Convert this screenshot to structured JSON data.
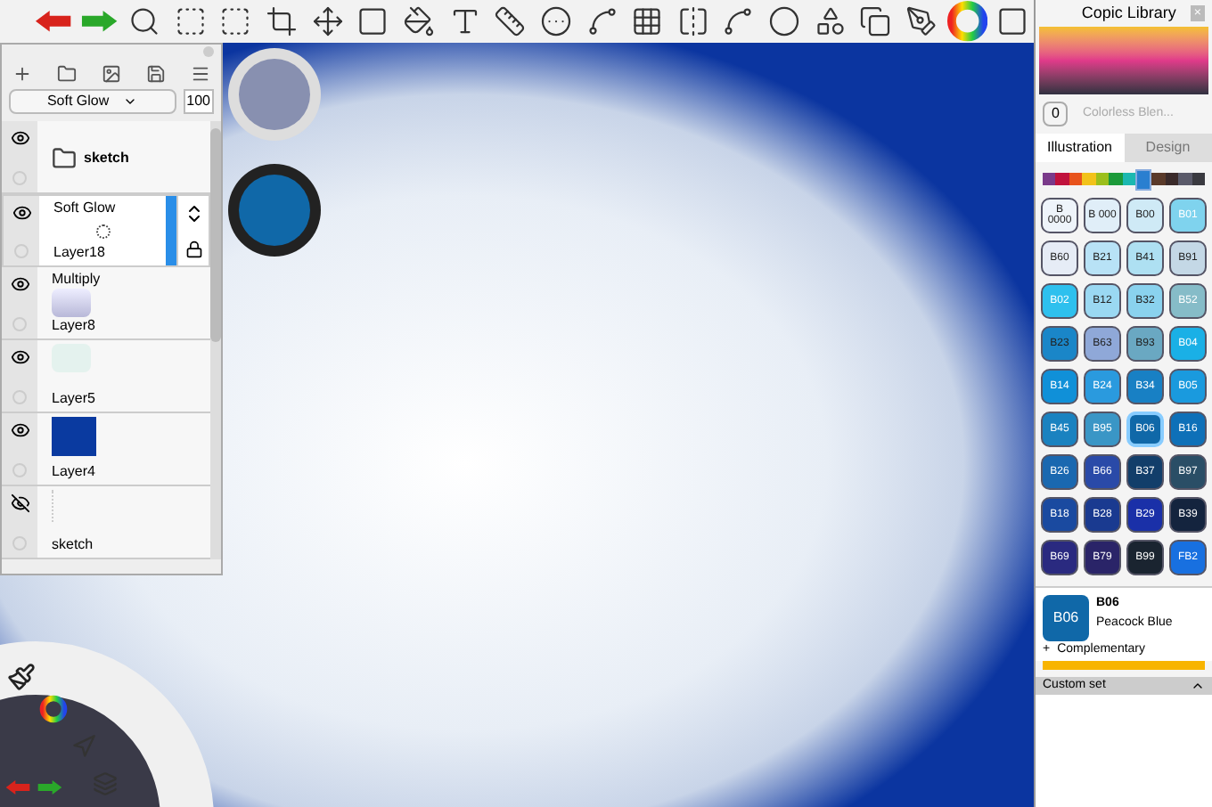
{
  "layers_panel": {
    "blend_mode": "Soft Glow",
    "opacity": "100",
    "layers": [
      {
        "kind": "group",
        "name": "sketch",
        "visible": true,
        "selected": false
      },
      {
        "kind": "glow",
        "blend": "Soft Glow",
        "name": "Layer18",
        "visible": true,
        "selected": true
      },
      {
        "kind": "cloud",
        "blend": "Multiply",
        "name": "Layer8",
        "visible": true,
        "selected": false
      },
      {
        "kind": "faint",
        "name": "Layer5",
        "visible": true,
        "selected": false
      },
      {
        "kind": "fill",
        "name": "Layer4",
        "visible": true,
        "selected": false
      },
      {
        "kind": "sketch",
        "name": "sketch",
        "visible": false,
        "selected": false
      }
    ]
  },
  "copic_library": {
    "title": "Copic Library",
    "close": "×",
    "blender_code": "0",
    "blender_name": "Colorless Blen...",
    "tabs": [
      {
        "label": "Illustration",
        "selected": true
      },
      {
        "label": "Design",
        "selected": false
      }
    ],
    "hues": [
      {
        "color": "#7a3a8a",
        "selected": false
      },
      {
        "color": "#c0123c",
        "selected": false
      },
      {
        "color": "#e8531c",
        "selected": false
      },
      {
        "color": "#f2c21a",
        "selected": false
      },
      {
        "color": "#9bbf1c",
        "selected": false
      },
      {
        "color": "#1c9a3a",
        "selected": false
      },
      {
        "color": "#1cb8b0",
        "selected": false
      },
      {
        "color": "#2a7fd0",
        "selected": true
      },
      {
        "color": "#5a3a2a",
        "selected": false
      },
      {
        "color": "#3a2a2a",
        "selected": false
      },
      {
        "color": "#5a5a6a",
        "selected": false
      },
      {
        "color": "#3a3a40",
        "selected": false
      }
    ],
    "swatches": [
      {
        "code": "B 0000",
        "color": "#eef4fa",
        "selected": false
      },
      {
        "code": "B 000",
        "color": "#e0eef8",
        "selected": false
      },
      {
        "code": "B00",
        "color": "#cfeaf6",
        "selected": false
      },
      {
        "code": "B01",
        "color": "#7fd3ee",
        "selected": false
      },
      {
        "code": "B60",
        "color": "#e6ecf6",
        "selected": false
      },
      {
        "code": "B21",
        "color": "#b8e2f6",
        "selected": false
      },
      {
        "code": "B41",
        "color": "#aee0f2",
        "selected": false
      },
      {
        "code": "B91",
        "color": "#c4d8e6",
        "selected": false
      },
      {
        "code": "B02",
        "color": "#2ec0ee",
        "selected": false
      },
      {
        "code": "B12",
        "color": "#9ad8f2",
        "selected": false
      },
      {
        "code": "B32",
        "color": "#8ad2ee",
        "selected": false
      },
      {
        "code": "B52",
        "color": "#86bcc8",
        "selected": false
      },
      {
        "code": "B23",
        "color": "#1a86c8",
        "selected": false
      },
      {
        "code": "B63",
        "color": "#8fa8d8",
        "selected": false
      },
      {
        "code": "B93",
        "color": "#6aa8c2",
        "selected": false
      },
      {
        "code": "B04",
        "color": "#1ab0e6",
        "selected": false
      },
      {
        "code": "B14",
        "color": "#1090d8",
        "selected": false
      },
      {
        "code": "B24",
        "color": "#2a9ade",
        "selected": false
      },
      {
        "code": "B34",
        "color": "#1880c4",
        "selected": false
      },
      {
        "code": "B05",
        "color": "#1a9ade",
        "selected": false
      },
      {
        "code": "B45",
        "color": "#1a82c0",
        "selected": false
      },
      {
        "code": "B95",
        "color": "#3a96c6",
        "selected": false
      },
      {
        "code": "B06",
        "color": "#1068a8",
        "selected": true
      },
      {
        "code": "B16",
        "color": "#0e70b8",
        "selected": false
      },
      {
        "code": "B26",
        "color": "#1a68b0",
        "selected": false
      },
      {
        "code": "B66",
        "color": "#2a4aa8",
        "selected": false
      },
      {
        "code": "B37",
        "color": "#123e6a",
        "selected": false
      },
      {
        "code": "B97",
        "color": "#2a4e66",
        "selected": false
      },
      {
        "code": "B18",
        "color": "#1a4aa0",
        "selected": false
      },
      {
        "code": "B28",
        "color": "#1a3a90",
        "selected": false
      },
      {
        "code": "B29",
        "color": "#1a30a8",
        "selected": false
      },
      {
        "code": "B39",
        "color": "#14243e",
        "selected": false
      },
      {
        "code": "B69",
        "color": "#2a2a80",
        "selected": false
      },
      {
        "code": "B79",
        "color": "#2a2468",
        "selected": false
      },
      {
        "code": "B99",
        "color": "#1a2430",
        "selected": false
      },
      {
        "code": "FB2",
        "color": "#1870e0",
        "selected": false
      }
    ],
    "current": {
      "code": "B06",
      "code_label": "B06",
      "name": "Peacock Blue",
      "color": "#1068a8"
    },
    "complementary": "Complementary",
    "complementary_toggle": "+",
    "custom_set": "Custom set"
  }
}
